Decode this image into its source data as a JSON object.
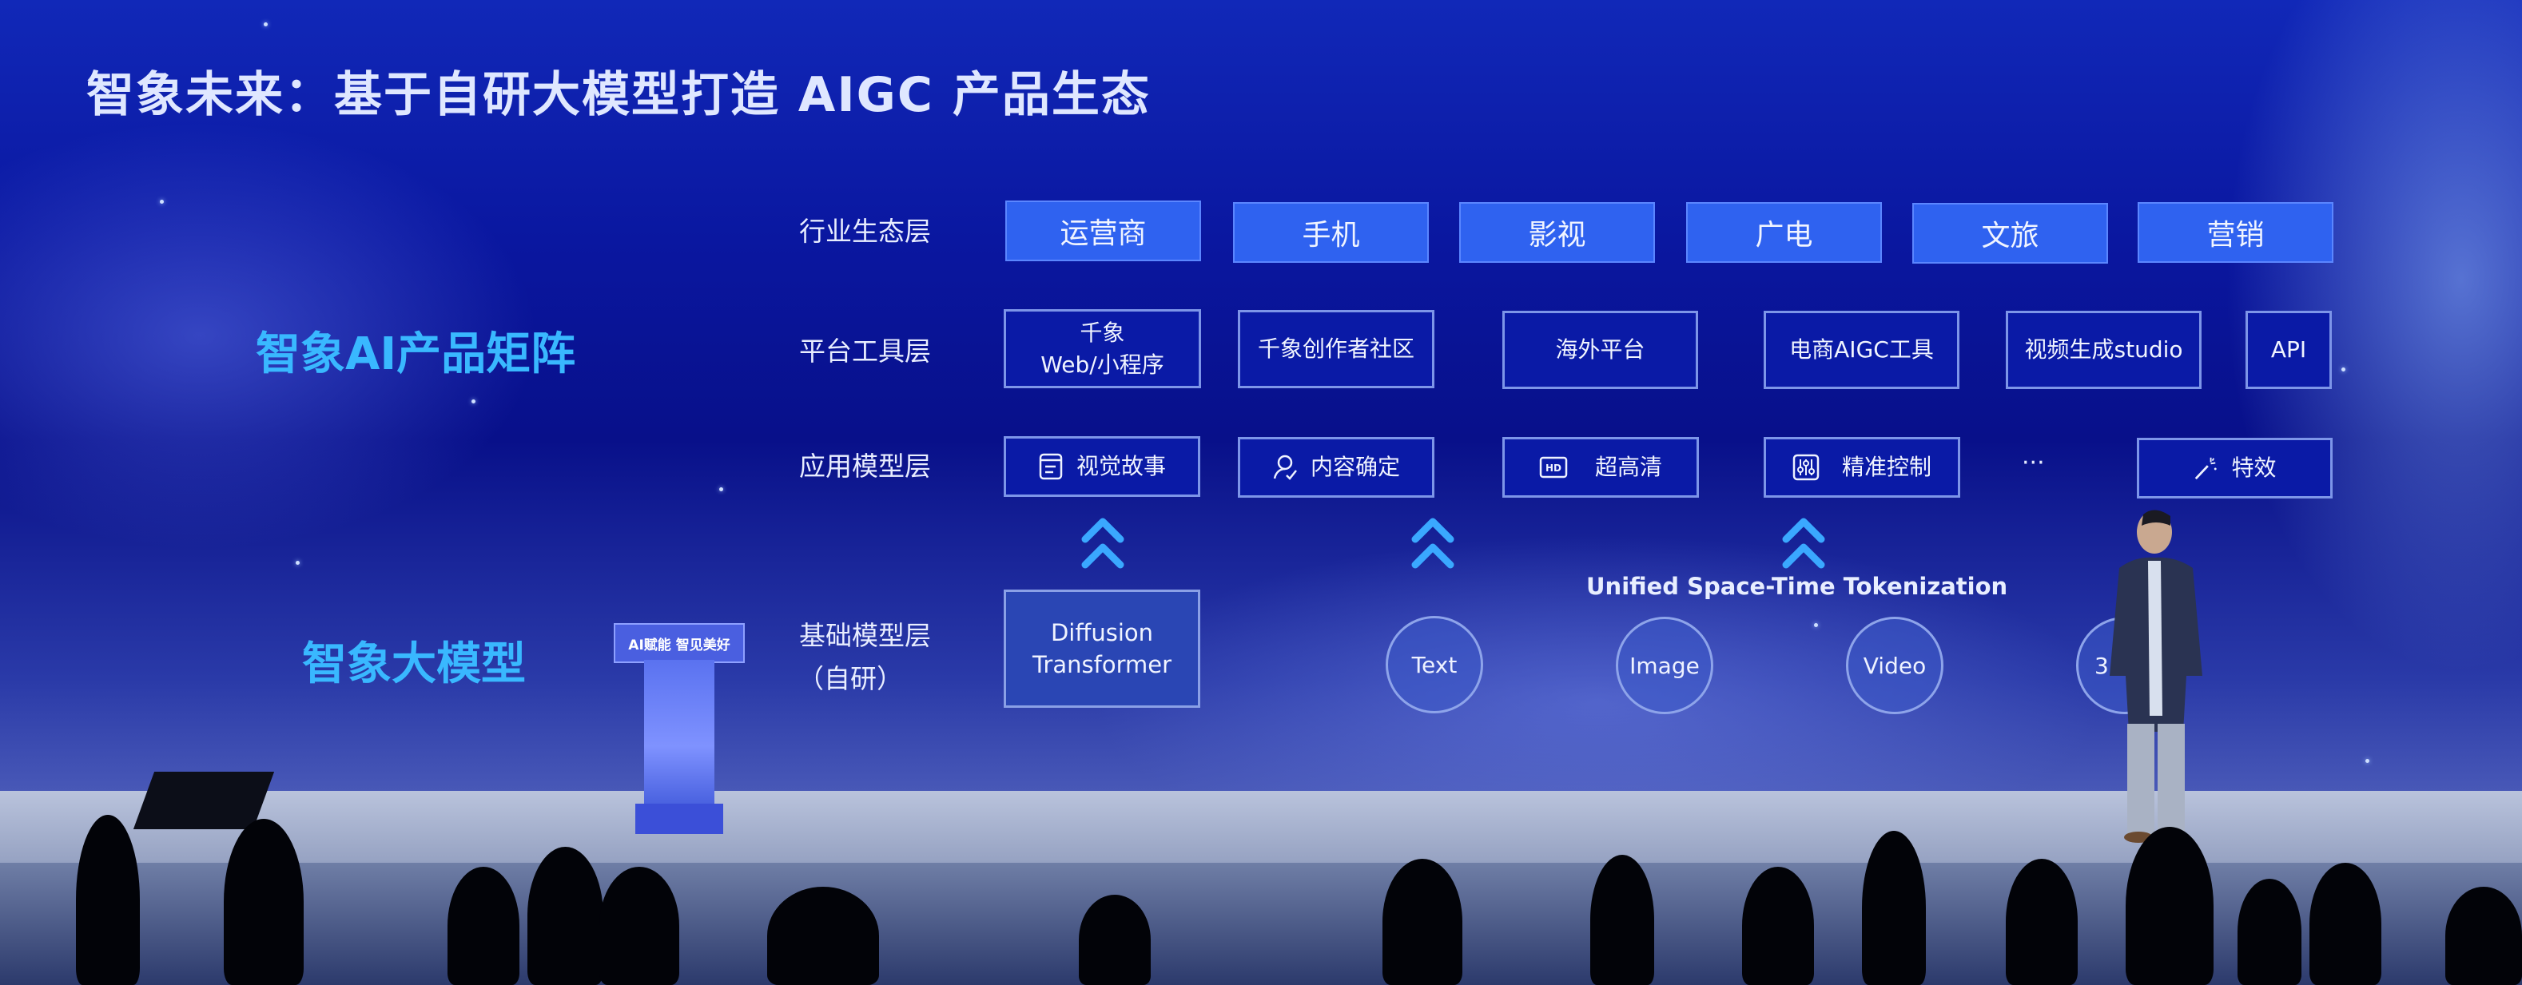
{
  "slide": {
    "title": "智象未来：基于自研大模型打造 AIGC 产品生态",
    "sections": {
      "product_matrix": "智象AI产品矩阵",
      "foundation_model": "智象大模型"
    },
    "rows": {
      "industry": {
        "label": "行业生态层",
        "items": [
          "运营商",
          "手机",
          "影视",
          "广电",
          "文旅",
          "营销"
        ]
      },
      "platform": {
        "label": "平台工具层",
        "items": [
          "千象\nWeb/小程序",
          "千象创作者社区",
          "海外平台",
          "电商AIGC工具",
          "视频生成studio",
          "API"
        ]
      },
      "application": {
        "label": "应用模型层",
        "items": [
          {
            "icon": "document-icon",
            "label": "视觉故事"
          },
          {
            "icon": "user-check-icon",
            "label": "内容确定"
          },
          {
            "icon": "hd-icon",
            "label": "超高清"
          },
          {
            "icon": "sliders-icon",
            "label": "精准控制"
          },
          {
            "icon": "magic-wand-icon",
            "label": "特效"
          }
        ],
        "ellipsis": "···"
      },
      "base": {
        "label_line1": "基础模型层",
        "label_line2": "（自研）",
        "architecture": "Diffusion\nTransformer",
        "tokenization": "Unified Space-Time Tokenization",
        "modalities": [
          "Text",
          "Image",
          "Video",
          "3"
        ]
      }
    },
    "colors": {
      "filled_box": "#2f62f0",
      "section_label": "#39b8ff",
      "chevron": "#3aa8ff"
    }
  },
  "podium": {
    "sign": "AI赋能 智见美好"
  }
}
